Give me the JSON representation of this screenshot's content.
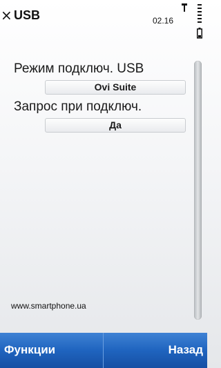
{
  "status_bar": {
    "close_glyph": "×",
    "title": "USB",
    "time": "02.16",
    "icons": [
      "close-icon",
      "signal-icon",
      "signal-bars-icon",
      "battery-icon"
    ]
  },
  "settings": [
    {
      "label": "Режим подключ. USB",
      "value": "Ovi Suite"
    },
    {
      "label": "Запрос при подключ.",
      "value": "Да"
    }
  ],
  "watermark": "www.smartphone.ua",
  "softkeys": {
    "left": "Функции",
    "right": "Назад"
  },
  "colors": {
    "softkey_bar": "#1f64bf",
    "background": "#f4f5f7",
    "text": "#1a1a1a"
  }
}
